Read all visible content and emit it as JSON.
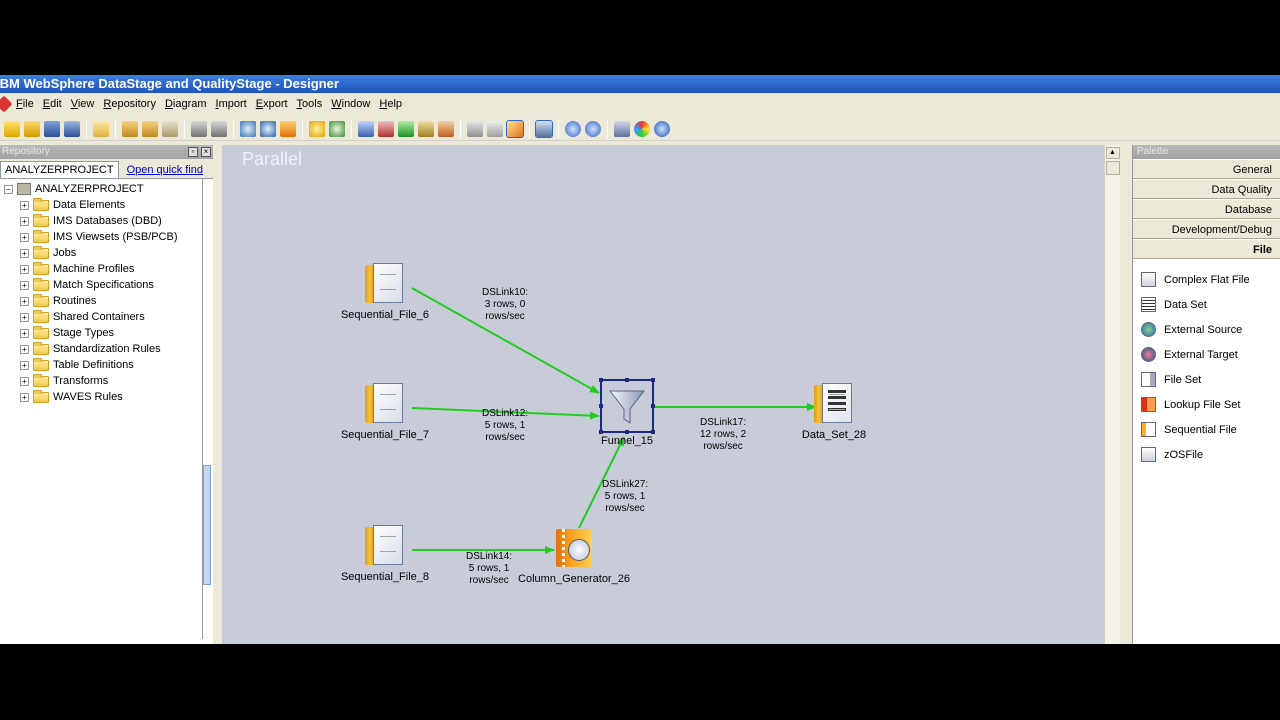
{
  "window": {
    "title": "IBM WebSphere DataStage and QualityStage - Designer"
  },
  "menu": [
    "File",
    "Edit",
    "View",
    "Repository",
    "Diagram",
    "Import",
    "Export",
    "Tools",
    "Window",
    "Help"
  ],
  "repository": {
    "header": "Repository",
    "tabs": {
      "active": "ANALYZERPROJECT",
      "link": "Open quick find"
    },
    "root": "ANALYZERPROJECT",
    "items": [
      "Data Elements",
      "IMS Databases (DBD)",
      "IMS Viewsets (PSB/PCB)",
      "Jobs",
      "Machine Profiles",
      "Match Specifications",
      "Routines",
      "Shared Containers",
      "Stage Types",
      "Standardization Rules",
      "Table Definitions",
      "Transforms",
      "WAVES Rules"
    ]
  },
  "canvas": {
    "label": "Parallel",
    "stages": {
      "seq6": "Sequential_File_6",
      "seq7": "Sequential_File_7",
      "seq8": "Sequential_File_8",
      "funnel": "Funnel_15",
      "dataset": "Data_Set_28",
      "colgen": "Column_Generator_26"
    },
    "links": {
      "l10": [
        "DSLink10:",
        "3 rows, 0",
        "rows/sec"
      ],
      "l12": [
        "DSLink12:",
        "5 rows, 1",
        "rows/sec"
      ],
      "l17": [
        "DSLink17:",
        "12 rows, 2",
        "rows/sec"
      ],
      "l27": [
        "DSLink27:",
        "5 rows, 1",
        "rows/sec"
      ],
      "l14": [
        "DSLink14:",
        "5 rows, 1",
        "rows/sec"
      ]
    },
    "link_color": "#22cc22"
  },
  "palette": {
    "header": "Palette",
    "categories": [
      "General",
      "Data Quality",
      "Database",
      "Development/Debug",
      "File"
    ],
    "active_category": "File",
    "items": [
      {
        "label": "Complex Flat File",
        "icon": "complex-flat-file-icon"
      },
      {
        "label": "Data Set",
        "icon": "data-set-icon"
      },
      {
        "label": "External Source",
        "icon": "external-source-icon"
      },
      {
        "label": "External Target",
        "icon": "external-target-icon"
      },
      {
        "label": "File Set",
        "icon": "file-set-icon"
      },
      {
        "label": "Lookup File Set",
        "icon": "lookup-file-set-icon"
      },
      {
        "label": "Sequential File",
        "icon": "sequential-file-icon"
      },
      {
        "label": "zOSFile",
        "icon": "zos-file-icon"
      }
    ]
  }
}
